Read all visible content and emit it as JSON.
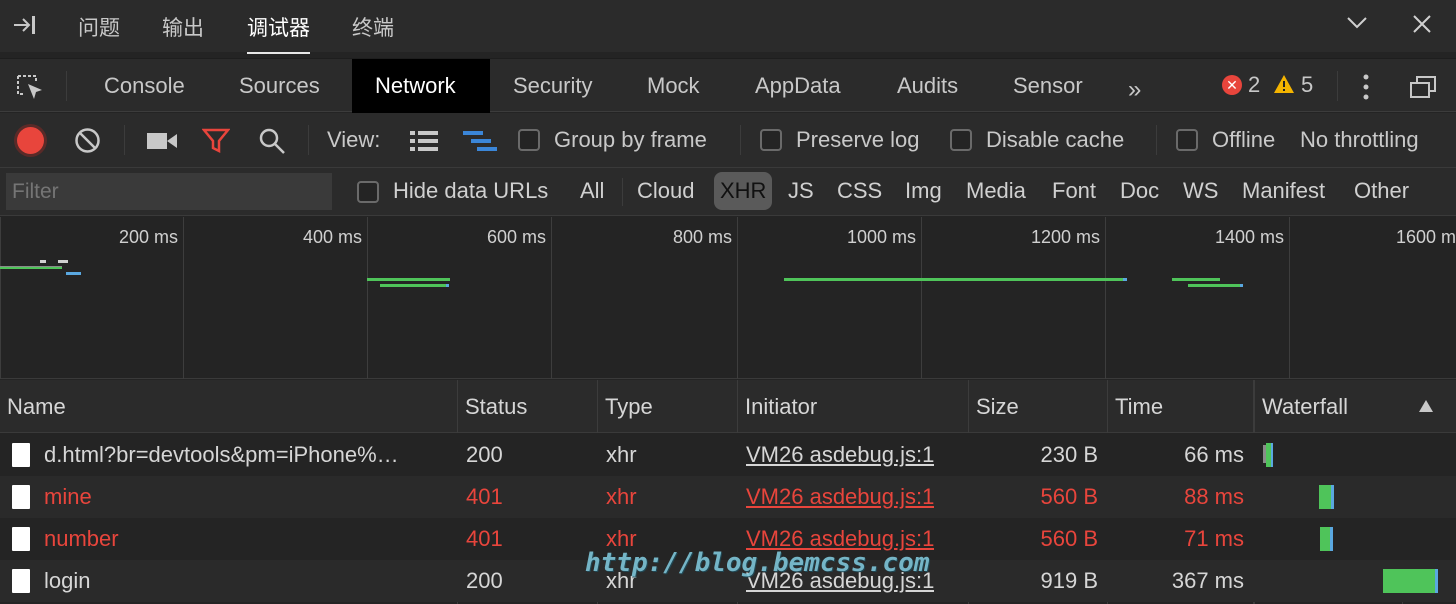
{
  "panel_tabs": [
    "问题",
    "输出",
    "调试器",
    "终端"
  ],
  "active_panel": "调试器",
  "devtools_tabs": [
    "Console",
    "Sources",
    "Network",
    "Security",
    "Mock",
    "AppData",
    "Audits",
    "Sensor"
  ],
  "active_devtools_tab": "Network",
  "errors_count": "2",
  "warnings_count": "5",
  "toolbar": {
    "view_label": "View:",
    "group_by_frame": "Group by frame",
    "preserve_log": "Preserve log",
    "disable_cache": "Disable cache",
    "offline": "Offline",
    "throttling": "No throttling"
  },
  "filter": {
    "placeholder": "Filter",
    "hide_data_urls": "Hide data URLs",
    "types": [
      "All",
      "Cloud",
      "XHR",
      "JS",
      "CSS",
      "Img",
      "Media",
      "Font",
      "Doc",
      "WS",
      "Manifest",
      "Other"
    ],
    "active_type": "XHR"
  },
  "overview_ticks": [
    "200 ms",
    "400 ms",
    "600 ms",
    "800 ms",
    "1000 ms",
    "1200 ms",
    "1400 ms",
    "1600 ms"
  ],
  "columns": [
    "Name",
    "Status",
    "Type",
    "Initiator",
    "Size",
    "Time",
    "Waterfall"
  ],
  "requests": [
    {
      "name": "d.html?br=devtools&pm=iPhone%…",
      "status": "200",
      "type": "xhr",
      "initiator": "VM26 asdebug.js:1",
      "size": "230 B",
      "time": "66 ms",
      "error": false
    },
    {
      "name": "mine",
      "status": "401",
      "type": "xhr",
      "initiator": "VM26 asdebug.js:1",
      "size": "560 B",
      "time": "88 ms",
      "error": true
    },
    {
      "name": "number",
      "status": "401",
      "type": "xhr",
      "initiator": "VM26 asdebug.js:1",
      "size": "560 B",
      "time": "71 ms",
      "error": true
    },
    {
      "name": "login",
      "status": "200",
      "type": "xhr",
      "initiator": "VM26 asdebug.js:1",
      "size": "919 B",
      "time": "367 ms",
      "error": false
    }
  ],
  "watermark": "http://blog.bemcss.com",
  "colors": {
    "error_text": "#e8453c",
    "record": "#e8453c",
    "filter_active": "#e8453c",
    "waterfall_green": "#4fc45a",
    "waterfall_blue": "#5aa8e0"
  }
}
